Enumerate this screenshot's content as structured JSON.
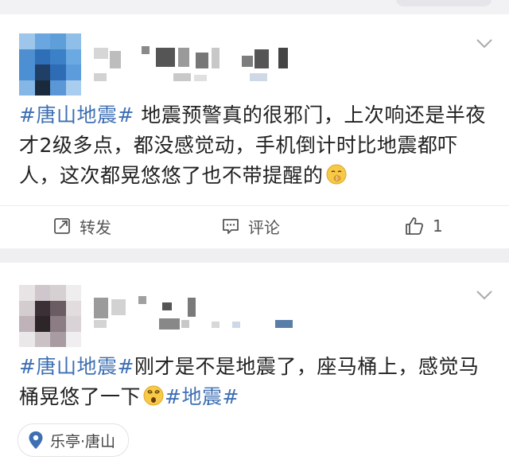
{
  "posts": [
    {
      "hashtag": "#唐山地震#",
      "text": " 地震预警真的很邪门，上次响还是半夜才2级多点，都没感觉动，手机倒计时比地震都吓人，这次都晃悠悠了也不带提醒的",
      "emoji": "shushing-face-emoji",
      "actions": {
        "repost_label": "转发",
        "comment_label": "评论",
        "like_count": "1"
      }
    },
    {
      "hashtag": "#唐山地震#",
      "text": "刚才是不是地震了，座马桶上，感觉马桶晃悠了一下",
      "emoji": "dizzy-face-emoji",
      "trailing_hashtag": "#地震#",
      "location": "乐亭·唐山"
    }
  ],
  "colors": {
    "hashtag": "#3e6fb3",
    "background": "#efeff1",
    "card": "#ffffff"
  },
  "icons": [
    "chevron-down-icon",
    "repost-icon",
    "comment-icon",
    "like-icon",
    "location-pin-icon"
  ]
}
